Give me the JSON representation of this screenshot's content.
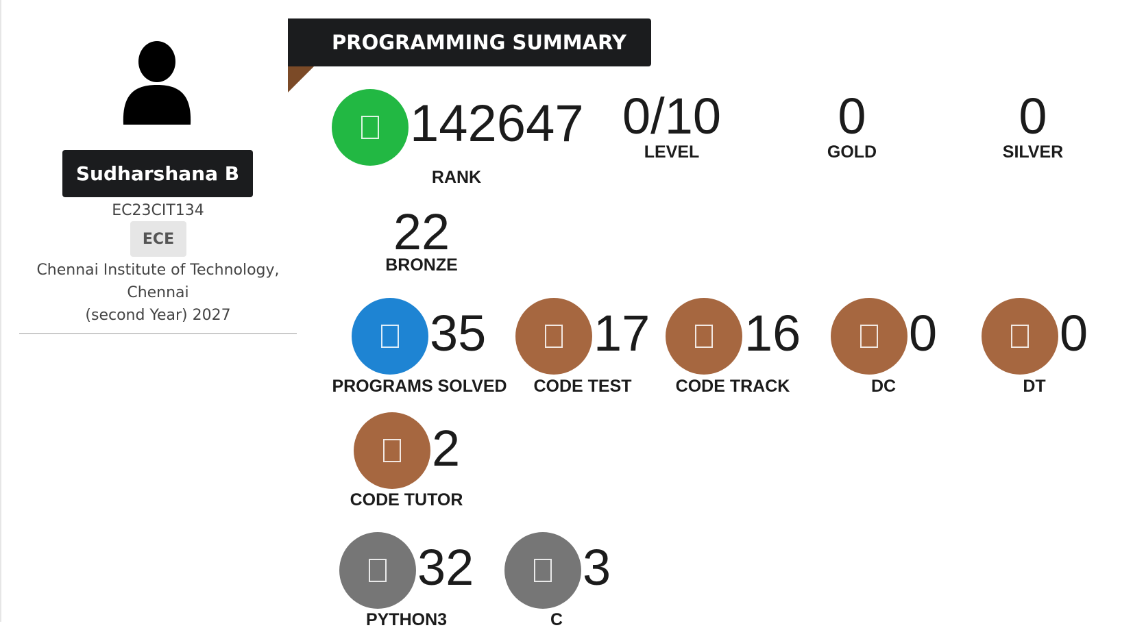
{
  "profile": {
    "name": "Sudharshana B",
    "register_no": "EC23CIT134",
    "department": "ECE",
    "college_line1": "Chennai Institute of Technology,",
    "college_line2": "Chennai",
    "year_line": "(second Year) 2027",
    "avatar_icon": "user-silhouette-icon"
  },
  "summary": {
    "title": "PROGRAMMING SUMMARY",
    "rank": {
      "value": "142647",
      "label": "RANK",
      "icon": "trophy-icon",
      "color": "#22b843"
    },
    "level": {
      "value": "0/10",
      "label": "LEVEL"
    },
    "gold": {
      "value": "0",
      "label": "GOLD"
    },
    "silver": {
      "value": "0",
      "label": "SILVER"
    },
    "bronze": {
      "value": "22",
      "label": "BRONZE"
    }
  },
  "modules": [
    {
      "value": "35",
      "label": "PROGRAMS SOLVED",
      "icon": "code-icon",
      "color": "#1e84d3"
    },
    {
      "value": "17",
      "label": "CODE TEST",
      "icon": "test-icon",
      "color": "#a66740"
    },
    {
      "value": "16",
      "label": "CODE TRACK",
      "icon": "track-icon",
      "color": "#a66740"
    },
    {
      "value": "0",
      "label": "DC",
      "icon": "dc-icon",
      "color": "#a66740"
    },
    {
      "value": "0",
      "label": "DT",
      "icon": "dt-icon",
      "color": "#a66740"
    },
    {
      "value": "2",
      "label": "CODE TUTOR",
      "icon": "tutor-icon",
      "color": "#a66740"
    }
  ],
  "languages": [
    {
      "value": "32",
      "label": "PYTHON3",
      "icon": "language-icon",
      "color": "#767676"
    },
    {
      "value": "3",
      "label": "C",
      "icon": "language-icon",
      "color": "#767676"
    }
  ]
}
